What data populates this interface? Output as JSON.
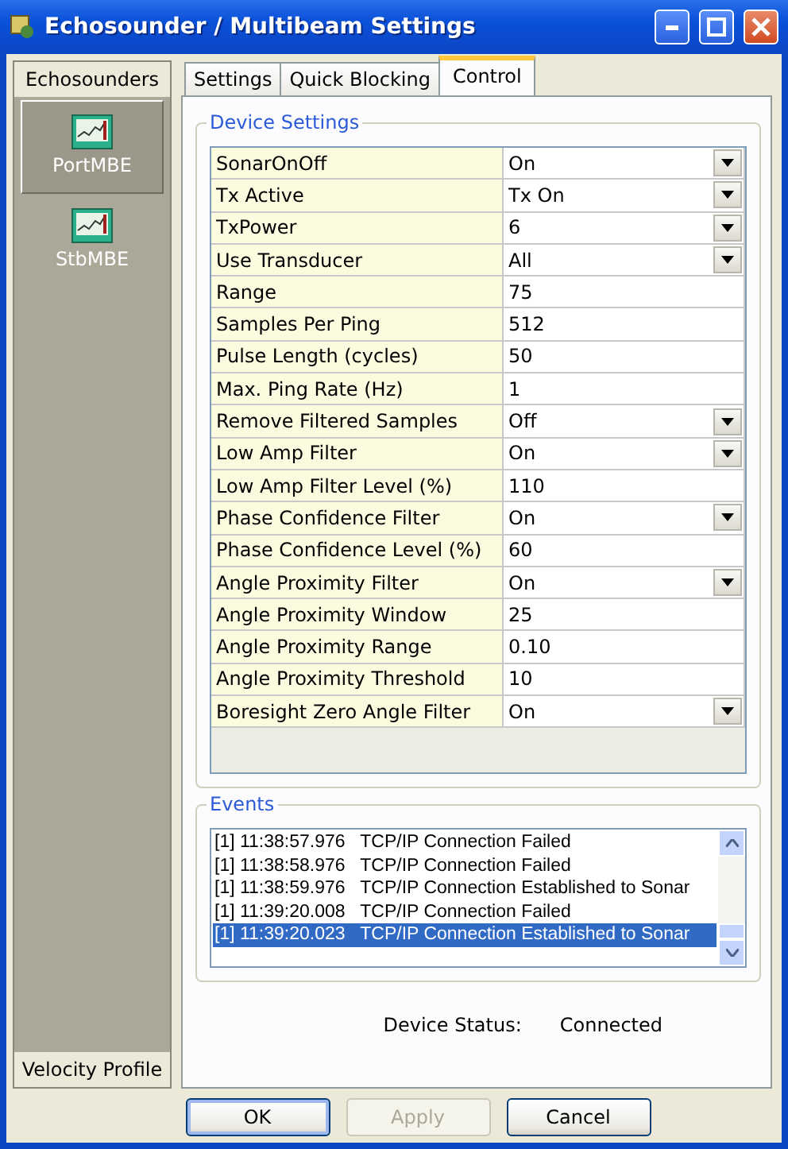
{
  "window": {
    "title": "Echosounder / Multibeam Settings"
  },
  "sidebar": {
    "header": "Echosounders",
    "items": [
      {
        "label": "PortMBE",
        "selected": true
      },
      {
        "label": "StbMBE",
        "selected": false
      }
    ],
    "footer": "Velocity Profile"
  },
  "tabs": [
    {
      "label": "Settings",
      "selected": false
    },
    {
      "label": "Quick Blocking",
      "selected": false
    },
    {
      "label": "Control",
      "selected": true
    }
  ],
  "device_settings": {
    "title": "Device Settings",
    "rows": [
      {
        "name": "SonarOnOff",
        "value": "On",
        "kind": "dropdown"
      },
      {
        "name": "Tx Active",
        "value": "Tx On",
        "kind": "dropdown"
      },
      {
        "name": "TxPower",
        "value": "6",
        "kind": "dropdown"
      },
      {
        "name": "Use Transducer",
        "value": "All",
        "kind": "dropdown"
      },
      {
        "name": "Range",
        "value": "75",
        "kind": "text"
      },
      {
        "name": "Samples Per Ping",
        "value": "512",
        "kind": "text"
      },
      {
        "name": "Pulse Length (cycles)",
        "value": "50",
        "kind": "text"
      },
      {
        "name": "Max. Ping Rate (Hz)",
        "value": "1",
        "kind": "text"
      },
      {
        "name": "Remove Filtered Samples",
        "value": "Off",
        "kind": "dropdown"
      },
      {
        "name": "Low Amp Filter",
        "value": "On",
        "kind": "dropdown"
      },
      {
        "name": "Low Amp Filter Level (%)",
        "value": "110",
        "kind": "text"
      },
      {
        "name": "Phase Confidence Filter",
        "value": "On",
        "kind": "dropdown"
      },
      {
        "name": "Phase Confidence Level (%)",
        "value": "60",
        "kind": "text"
      },
      {
        "name": "Angle Proximity Filter",
        "value": "On",
        "kind": "dropdown"
      },
      {
        "name": "Angle Proximity Window",
        "value": "25",
        "kind": "text"
      },
      {
        "name": "Angle Proximity Range",
        "value": "0.10",
        "kind": "text"
      },
      {
        "name": "Angle Proximity Threshold",
        "value": "10",
        "kind": "text"
      },
      {
        "name": "Boresight Zero Angle Filter",
        "value": "On",
        "kind": "dropdown"
      }
    ]
  },
  "events": {
    "title": "Events",
    "items": [
      {
        "text": "[1] 11:38:57.976   TCP/IP Connection Failed",
        "selected": false
      },
      {
        "text": "[1] 11:38:58.976   TCP/IP Connection Failed",
        "selected": false
      },
      {
        "text": "[1] 11:38:59.976   TCP/IP Connection Established to Sonar",
        "selected": false
      },
      {
        "text": "[1] 11:39:20.008   TCP/IP Connection Failed",
        "selected": false
      },
      {
        "text": "[1] 11:39:20.023   TCP/IP Connection Established to Sonar",
        "selected": true
      }
    ]
  },
  "status": {
    "label": "Device Status:",
    "value": "Connected"
  },
  "buttons": [
    {
      "label": "OK",
      "disabled": false,
      "default": true
    },
    {
      "label": "Apply",
      "disabled": true,
      "default": false
    },
    {
      "label": "Cancel",
      "disabled": false,
      "default": false
    }
  ]
}
